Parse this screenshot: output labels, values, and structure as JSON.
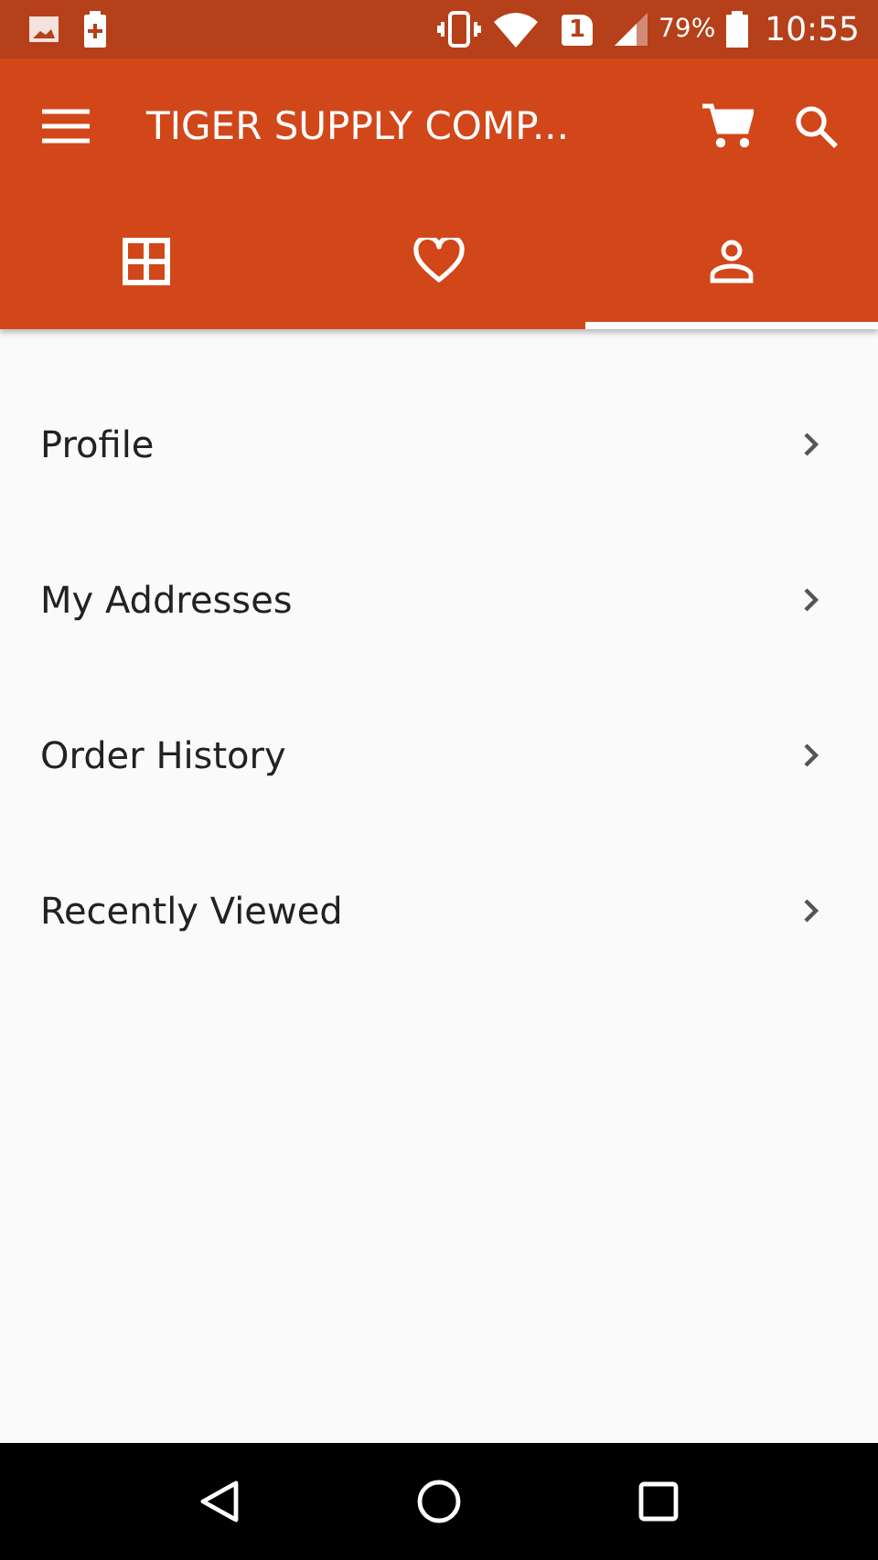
{
  "status_bar": {
    "sim": "1",
    "battery": "79%",
    "time": "10:55"
  },
  "toolbar": {
    "title": "TIGER SUPPLY COMP..."
  },
  "tabs": [
    {
      "kind": "grid",
      "selected": false
    },
    {
      "kind": "heart",
      "selected": false
    },
    {
      "kind": "person",
      "selected": true
    }
  ],
  "menu": [
    {
      "label": "Profile"
    },
    {
      "label": "My Addresses"
    },
    {
      "label": "Order History"
    },
    {
      "label": "Recently Viewed"
    }
  ]
}
